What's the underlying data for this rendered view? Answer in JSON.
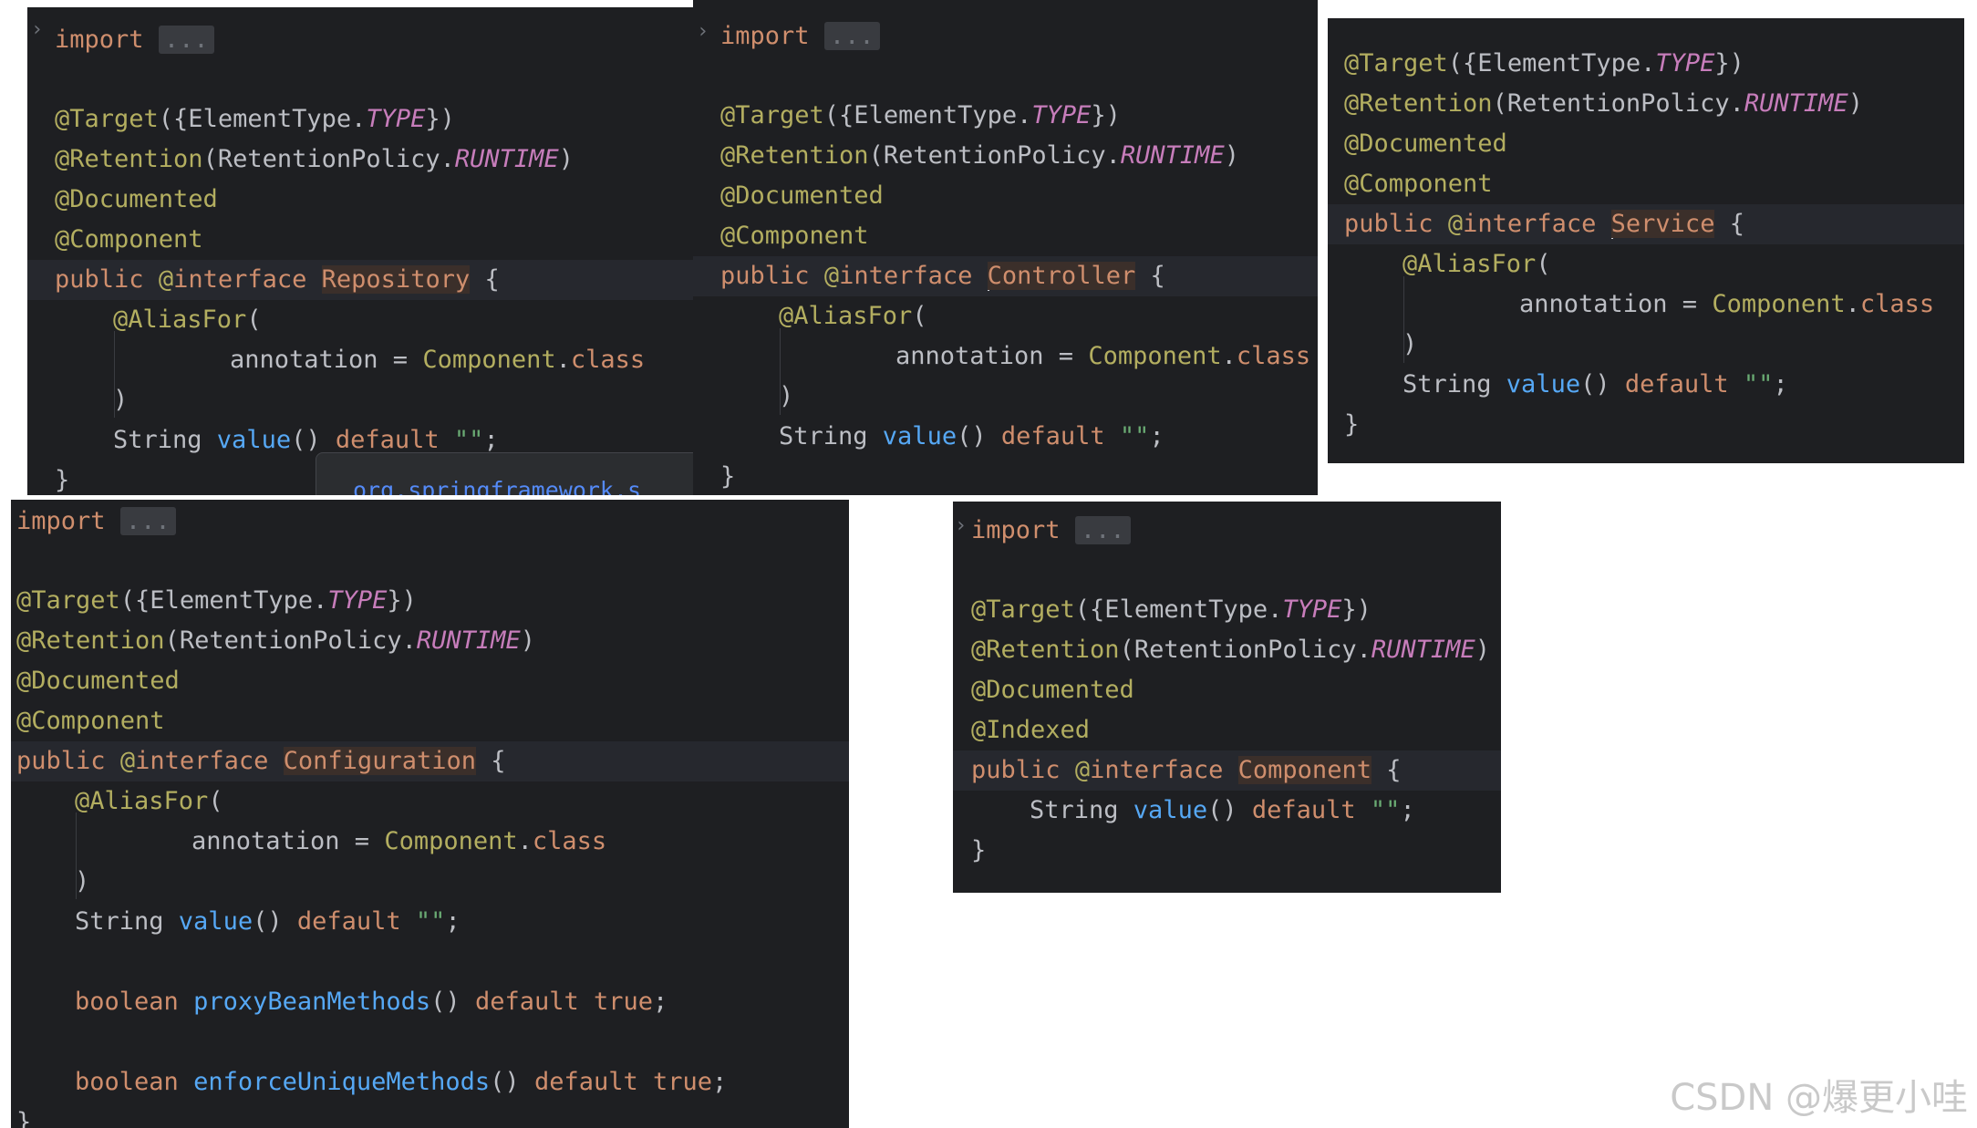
{
  "colors": {
    "bg": "#1e1f22",
    "annotation": "#b3ae60",
    "keyword": "#cf8e6d",
    "constant": "#c77dbb",
    "method": "#56a8f5",
    "text": "#bcbec4"
  },
  "common": {
    "import_kw": "import",
    "fold": "...",
    "target": "@Target({ElementType.TYPE})",
    "retention": "@Retention(RetentionPolicy.RUNTIME)",
    "documented": "@Documented",
    "component_ann": "@Component",
    "indexed_ann": "@Indexed",
    "alias_open": "@AliasFor(",
    "alias_attr": "annotation = Component.class",
    "alias_close": ")",
    "value_decl": "String value() default \"\";",
    "close_brace": "}"
  },
  "panels": [
    {
      "id": "repository",
      "decl": "public @interface Repository {",
      "name": "Repository"
    },
    {
      "id": "controller",
      "decl": "public @interface Controller {",
      "name": "Controller"
    },
    {
      "id": "service",
      "decl": "public @interface Service {",
      "name": "Service"
    },
    {
      "id": "configuration",
      "decl": "public @interface Configuration {",
      "name": "Configuration",
      "extra": [
        "boolean proxyBeanMethods() default true;",
        "boolean enforceUniqueMethods() default true;"
      ]
    },
    {
      "id": "component",
      "decl": "public @interface Component {",
      "name": "Component"
    }
  ],
  "popup_text": "org.springframework.s",
  "watermark": "CSDN @爆更小哇"
}
